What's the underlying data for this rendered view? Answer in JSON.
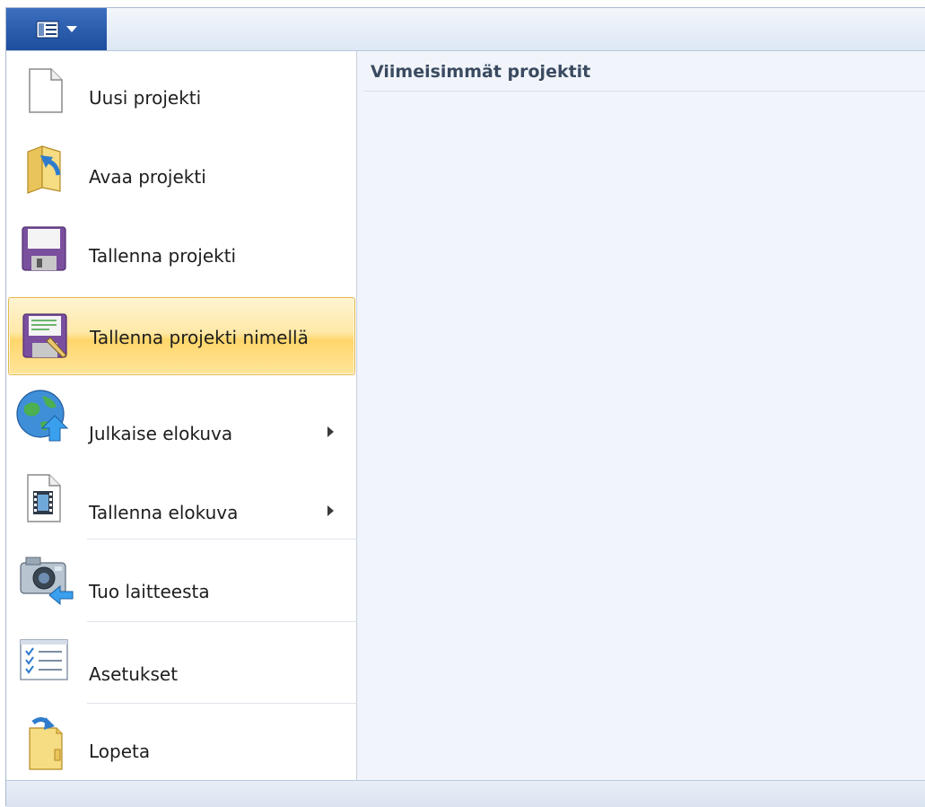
{
  "window": {
    "accent": "#2a5ba8",
    "highlight": "#ffe08a"
  },
  "app_menu": {
    "button_icon": "menu-dropdown-icon",
    "items": [
      {
        "id": "new",
        "label": "Uusi projekti",
        "icon": "new-document-icon",
        "has_submenu": false,
        "highlighted": false
      },
      {
        "id": "open",
        "label": "Avaa projekti",
        "icon": "open-folder-icon",
        "has_submenu": false,
        "highlighted": false
      },
      {
        "id": "save",
        "label": "Tallenna projekti",
        "icon": "floppy-disk-icon",
        "has_submenu": false,
        "highlighted": false
      },
      {
        "id": "save-as",
        "label": "Tallenna projekti nimellä",
        "icon": "floppy-disk-edit-icon",
        "has_submenu": false,
        "highlighted": true
      },
      {
        "id": "publish",
        "label": "Julkaise elokuva",
        "icon": "globe-upload-icon",
        "has_submenu": true,
        "highlighted": false
      },
      {
        "id": "save-movie",
        "label": "Tallenna elokuva",
        "icon": "film-document-icon",
        "has_submenu": true,
        "highlighted": false
      },
      {
        "id": "import",
        "label": "Tuo laitteesta",
        "icon": "camera-import-icon",
        "has_submenu": false,
        "highlighted": false
      },
      {
        "id": "options",
        "label": "Asetukset",
        "icon": "checklist-icon",
        "has_submenu": false,
        "highlighted": false
      },
      {
        "id": "exit",
        "label": "Lopeta",
        "icon": "exit-door-icon",
        "has_submenu": false,
        "highlighted": false
      }
    ]
  },
  "recent": {
    "title": "Viimeisimmät projektit"
  }
}
